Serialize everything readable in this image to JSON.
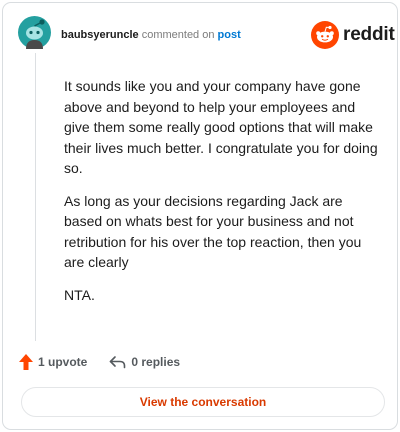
{
  "comment": {
    "author": "baubsyeruncle",
    "meta_text": "commented on",
    "post_link": "post",
    "paragraphs": [
      "It sounds like you and your company have gone above and beyond to help your employees and give them some really good options that will make their lives much better. I congratulate you for doing so.",
      "As long as your decisions regarding Jack are based on whats best for your business and not retribution for his over the top reaction, then you are clearly",
      "NTA."
    ]
  },
  "brand": {
    "wordmark": "reddit",
    "accent_color": "#ff4500",
    "avatar_color": "#24a0a0"
  },
  "actions": {
    "upvote_label": "1 upvote",
    "replies_label": "0 replies"
  },
  "footer": {
    "button_label": "View the conversation"
  }
}
